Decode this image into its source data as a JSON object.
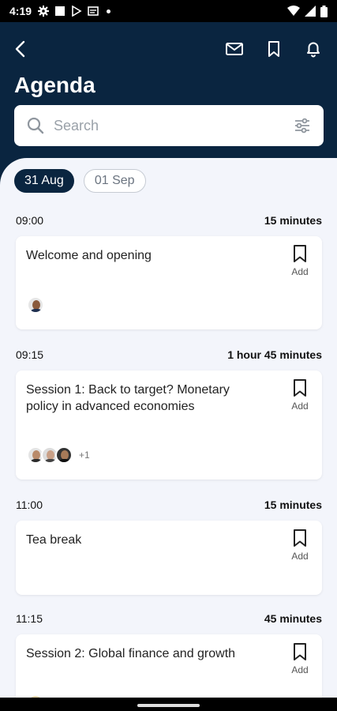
{
  "status_bar": {
    "time": "4:19"
  },
  "header": {
    "title": "Agenda"
  },
  "search": {
    "placeholder": "Search"
  },
  "dates": [
    {
      "label": "31 Aug",
      "active": true
    },
    {
      "label": "01 Sep",
      "active": false
    }
  ],
  "bookmark_label": "Add",
  "sessions": [
    {
      "start": "09:00",
      "duration": "15 minutes",
      "title": "Welcome and opening",
      "speaker_count": 1,
      "more": ""
    },
    {
      "start": "09:15",
      "duration": "1 hour 45 minutes",
      "title": "Session 1: Back to target? Monetary policy in advanced economies",
      "speaker_count": 3,
      "more": "+1"
    },
    {
      "start": "11:00",
      "duration": "15 minutes",
      "title": "Tea break",
      "speaker_count": 0,
      "more": ""
    },
    {
      "start": "11:15",
      "duration": "45 minutes",
      "title": "Session 2: Global finance and growth",
      "speaker_count": 1,
      "more": ""
    }
  ],
  "colors": {
    "header_bg": "#0a2540",
    "content_bg": "#f3f5fb",
    "active_chip": "#0a2540"
  }
}
